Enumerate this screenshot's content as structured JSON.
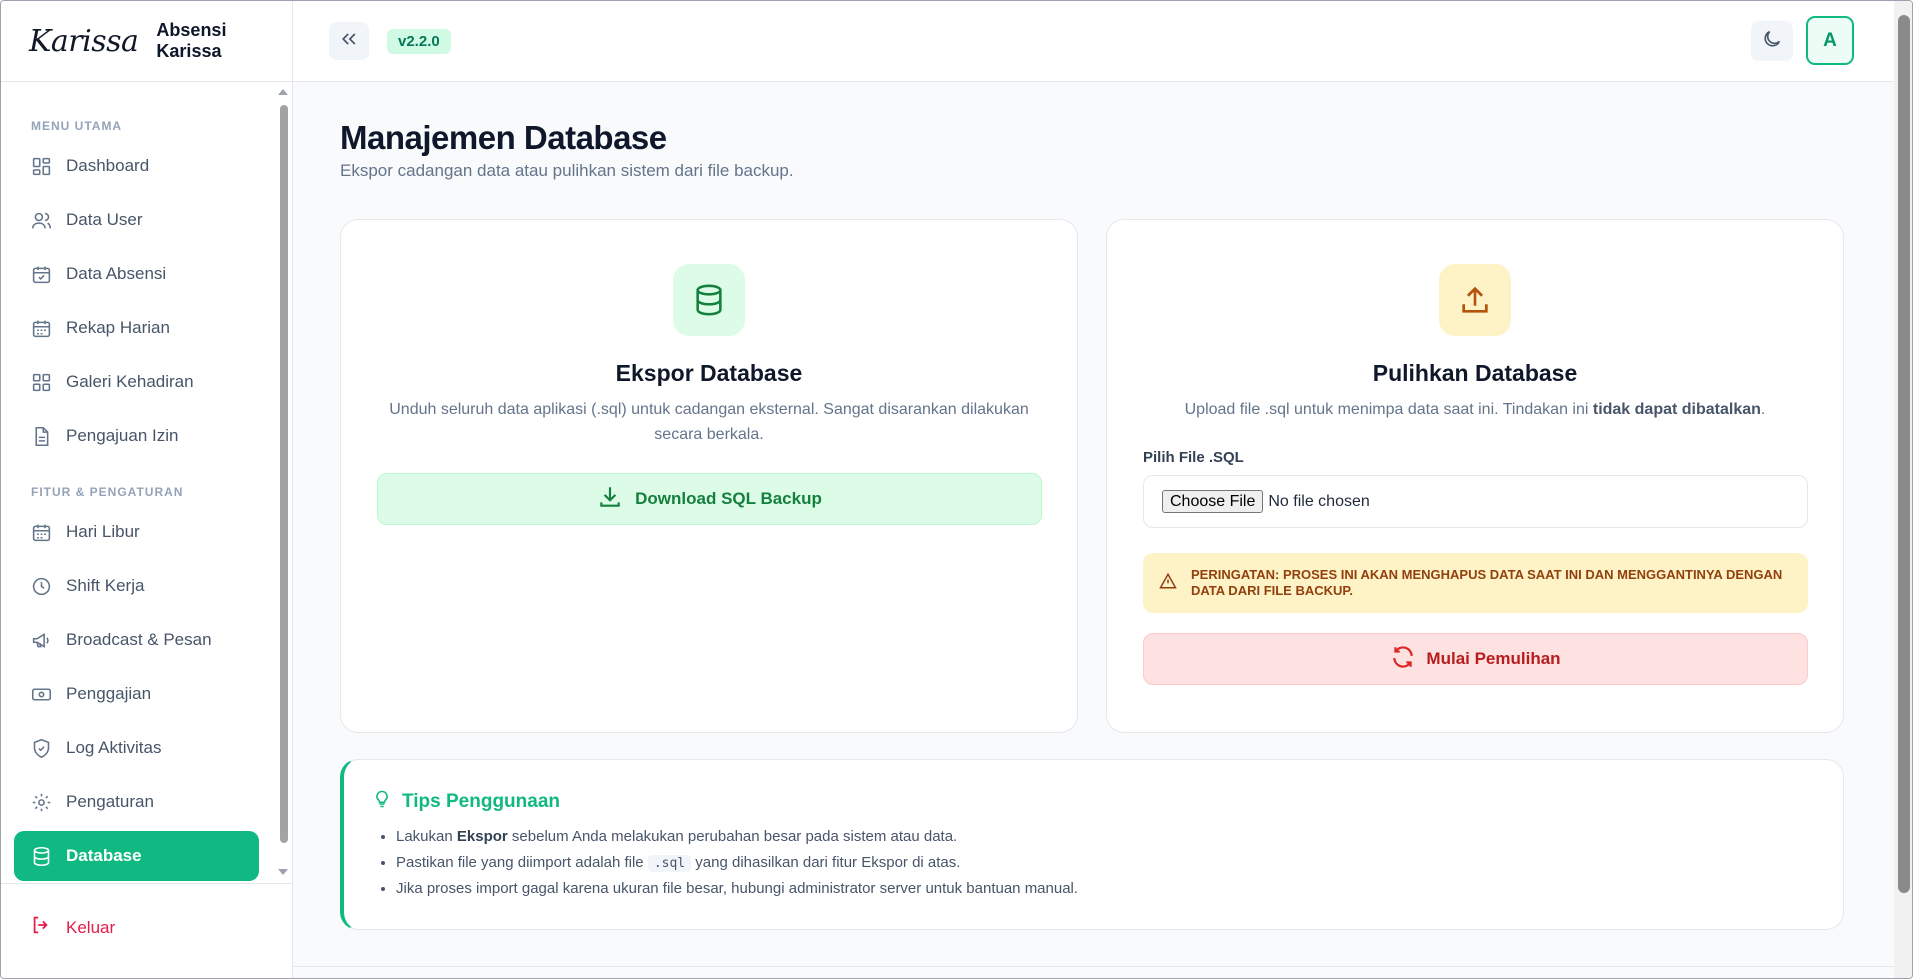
{
  "brand": {
    "logo": "Karissa",
    "name": "Absensi Karissa"
  },
  "header": {
    "version": "v2.2.0",
    "avatar_initial": "A"
  },
  "sidebar": {
    "section_main": "MENU UTAMA",
    "section_features": "FITUR & PENGATURAN",
    "items": [
      {
        "label": "Dashboard",
        "icon": "dashboard-icon"
      },
      {
        "label": "Data User",
        "icon": "users-icon"
      },
      {
        "label": "Data Absensi",
        "icon": "calendar-check-icon"
      },
      {
        "label": "Rekap Harian",
        "icon": "calendar-icon"
      },
      {
        "label": "Galeri Kehadiran",
        "icon": "gallery-icon"
      },
      {
        "label": "Pengajuan Izin",
        "icon": "document-icon"
      },
      {
        "label": "Hari Libur",
        "icon": "calendar-icon"
      },
      {
        "label": "Shift Kerja",
        "icon": "clock-icon"
      },
      {
        "label": "Broadcast & Pesan",
        "icon": "megaphone-icon"
      },
      {
        "label": "Penggajian",
        "icon": "banknote-icon"
      },
      {
        "label": "Log Aktivitas",
        "icon": "shield-icon"
      },
      {
        "label": "Pengaturan",
        "icon": "gear-icon"
      },
      {
        "label": "Database",
        "icon": "database-icon",
        "active": true
      }
    ],
    "logout": "Keluar"
  },
  "main": {
    "title": "Manajemen Database",
    "subtitle": "Ekspor cadangan data atau pulihkan sistem dari file backup.",
    "export": {
      "title": "Ekspor Database",
      "description": "Unduh seluruh data aplikasi (.sql) untuk cadangan eksternal. Sangat disarankan dilakukan secara berkala.",
      "button": "Download SQL Backup"
    },
    "restore": {
      "title": "Pulihkan Database",
      "description_before": "Upload file .sql untuk menimpa data saat ini. Tindakan ini ",
      "description_bold": "tidak dapat dibatalkan",
      "description_after": ".",
      "file_label": "Pilih File .SQL",
      "choose_button": "Choose File",
      "no_file": "No file chosen",
      "warning": "PERINGATAN: PROSES INI AKAN MENGHAPUS DATA SAAT INI DAN MENGGANTINYA DENGAN DATA DARI FILE BACKUP.",
      "button": "Mulai Pemulihan"
    },
    "tips": {
      "title": "Tips Penggunaan",
      "tip1_before": "Lakukan ",
      "tip1_bold": "Ekspor",
      "tip1_after": " sebelum Anda melakukan perubahan besar pada sistem atau data.",
      "tip2_before": "Pastikan file yang diimport adalah file ",
      "tip2_code": ".sql",
      "tip2_after": " yang dihasilkan dari fitur Ekspor di atas.",
      "tip3": "Jika proses import gagal karena ukuran file besar, hubungi administrator server untuk bantuan manual."
    }
  },
  "colors": {
    "accent": "#10b981",
    "warning_bg": "#fef3c7",
    "danger_bg": "#fee2e2"
  }
}
